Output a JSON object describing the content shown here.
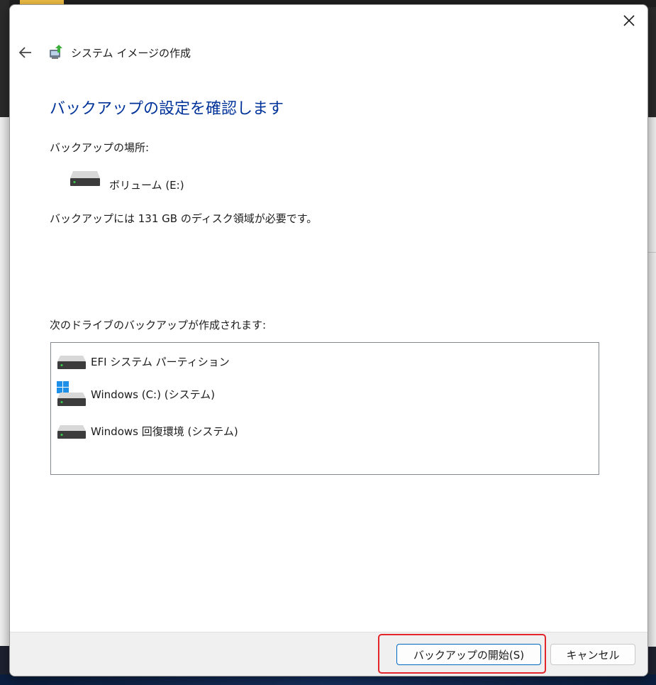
{
  "dialog": {
    "title": "システム イメージの作成",
    "heading": "バックアップの設定を確認します",
    "location_label": "バックアップの場所:",
    "location_drive": "ボリューム (E:)",
    "space_text": "バックアップには 131 GB のディスク領域が必要です。",
    "drives_label": "次のドライブのバックアップが作成されます:",
    "drives": [
      {
        "name": "EFI システム パーティション",
        "icon": "drive-icon"
      },
      {
        "name": "Windows (C:) (システム)",
        "icon": "windows-drive-icon"
      },
      {
        "name": "Windows 回復環境 (システム)",
        "icon": "drive-icon"
      }
    ]
  },
  "footer": {
    "start_label": "バックアップの開始(S)",
    "cancel_label": "キャンセル"
  },
  "colors": {
    "heading": "#003399",
    "highlight": "#e3262b",
    "primary_border": "#0067c0"
  }
}
